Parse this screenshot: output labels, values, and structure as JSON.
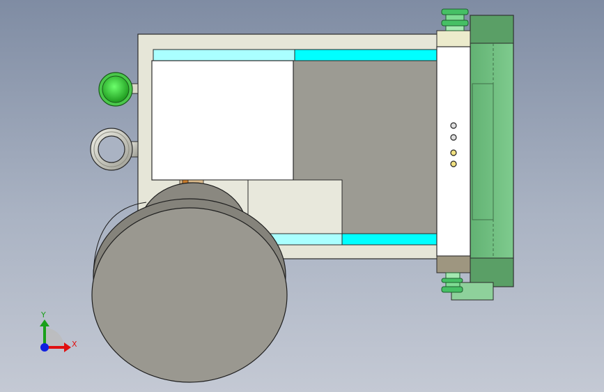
{
  "viewport": {
    "background_top": "#7f8ca3",
    "background_bottom": "#c4c9d4"
  },
  "triad": {
    "x_label": "X",
    "y_label": "Y",
    "x_color": "#e01010",
    "y_color": "#1aa01a",
    "z_color": "#1020e0"
  },
  "colors": {
    "frame": "#e6e6d8",
    "cyan": "#00ffff",
    "light_cyan": "#aaffff",
    "gray_block": "#9c9b93",
    "white_panel": "#ffffff",
    "green_dark": "#5aa86a",
    "green_light": "#7cc88a",
    "roll": "#8e8c84",
    "indicator": "#3ee43e"
  },
  "icons": {
    "green_knob": "indicator-knob-icon",
    "eye_bolt": "eye-bolt-icon",
    "axis_triad": "axis-triad-icon"
  }
}
